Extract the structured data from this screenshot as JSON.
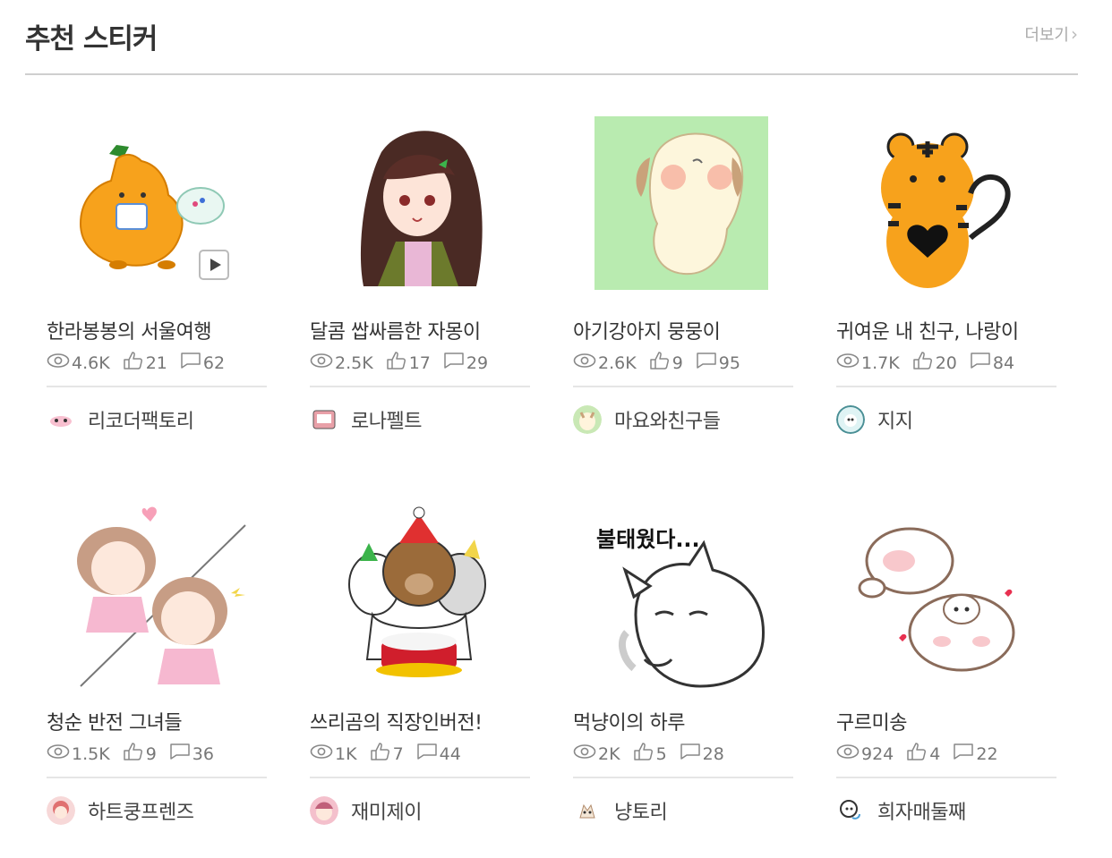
{
  "header": {
    "title": "추천 스티커",
    "more_label": "더보기",
    "more_chevron": "›"
  },
  "cards": [
    {
      "name": "한라봉봉의 서울여행",
      "views": "4.6K",
      "likes": "21",
      "comments": "62",
      "author": "리코더팩토리",
      "thumb": "orange-character-sticker",
      "animated": true
    },
    {
      "name": "달콤 쌉싸름한 자몽이",
      "views": "2.5K",
      "likes": "17",
      "comments": "29",
      "author": "로나펠트",
      "thumb": "girl-character-sticker",
      "animated": false
    },
    {
      "name": "아기강아지 뭉뭉이",
      "views": "2.6K",
      "likes": "9",
      "comments": "95",
      "author": "마요와친구들",
      "thumb": "puppy-sticker",
      "animated": false
    },
    {
      "name": "귀여운 내 친구, 나랑이",
      "views": "1.7K",
      "likes": "20",
      "comments": "84",
      "author": "지지",
      "thumb": "tiger-sticker",
      "animated": false
    },
    {
      "name": "청순 반전 그녀들",
      "views": "1.5K",
      "likes": "9",
      "comments": "36",
      "author": "하트쿵프렌즈",
      "thumb": "two-girls-sticker",
      "animated": false
    },
    {
      "name": "쓰리곰의 직장인버전!",
      "views": "1K",
      "likes": "7",
      "comments": "44",
      "author": "재미제이",
      "thumb": "bear-cake-sticker",
      "animated": false
    },
    {
      "name": "먹냥이의 하루",
      "views": "2K",
      "likes": "5",
      "comments": "28",
      "author": "냥토리",
      "thumb": "cat-sticker",
      "thumb_text": "불태웠다...",
      "animated": false
    },
    {
      "name": "구르미송",
      "views": "924",
      "likes": "4",
      "comments": "22",
      "author": "희자매둘째",
      "thumb": "sheep-sticker",
      "animated": false
    }
  ],
  "icons": {
    "views": "eye-icon",
    "likes": "thumbs-up-icon",
    "comments": "comment-icon",
    "play": "play-icon"
  },
  "colors": {
    "text": "#333333",
    "meta": "#777777",
    "divider": "#e5e5e5",
    "header_line": "#cfcfcf",
    "puppy_bg": "#b9ebb0"
  }
}
